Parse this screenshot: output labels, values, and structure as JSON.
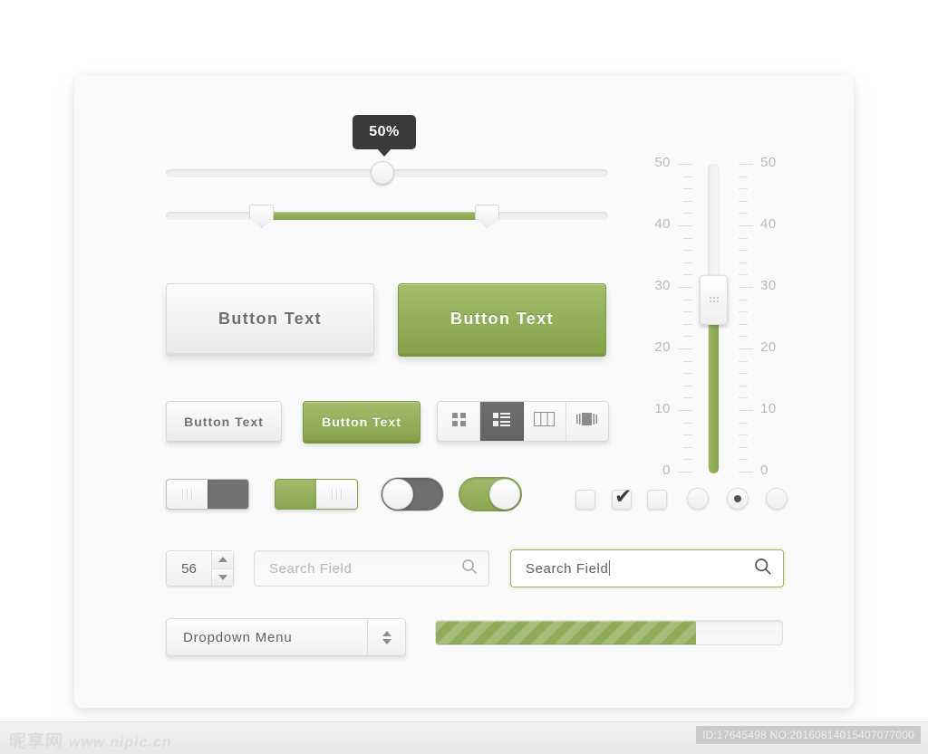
{
  "tooltip": {
    "value": "50%"
  },
  "sliders": {
    "single": {
      "value": 50,
      "min": 0,
      "max": 100,
      "tooltip": "50%"
    },
    "range": {
      "low": 19,
      "high": 70,
      "min": 0,
      "max": 100
    }
  },
  "buttons": {
    "big_light": "Button Text",
    "big_green": "Button Text",
    "small_light": "Button Text",
    "small_green": "Button Text"
  },
  "segmented": {
    "active_index": 1,
    "items": [
      {
        "icon": "grid-view-icon",
        "label": "Grid"
      },
      {
        "icon": "list-view-icon",
        "label": "List"
      },
      {
        "icon": "column-view-icon",
        "label": "Columns"
      },
      {
        "icon": "coverflow-view-icon",
        "label": "Coverflow"
      }
    ]
  },
  "toggles": [
    {
      "name": "square-toggle-off",
      "state": "off",
      "style": "square",
      "color": "#727272"
    },
    {
      "name": "square-toggle-on",
      "state": "on",
      "style": "square",
      "color": "#9ab461"
    },
    {
      "name": "round-toggle-off",
      "state": "off",
      "style": "round",
      "color": "#6e6e6e"
    },
    {
      "name": "round-toggle-on",
      "state": "on",
      "style": "round",
      "color": "#9ab461"
    }
  ],
  "checkboxes": [
    {
      "checked": false
    },
    {
      "checked": true,
      "mark": "✔"
    },
    {
      "checked": false
    }
  ],
  "radios": [
    {
      "selected": false
    },
    {
      "selected": true
    },
    {
      "selected": false
    }
  ],
  "stepper": {
    "value": "56",
    "up_icon": "triangle-up-icon",
    "down_icon": "triangle-down-icon"
  },
  "search_fields": [
    {
      "placeholder": "Search Field",
      "value": "",
      "focused": false,
      "icon": "search-icon"
    },
    {
      "placeholder": "Search Field",
      "value": "Search Field",
      "focused": true,
      "icon": "search-icon"
    }
  ],
  "dropdown": {
    "label": "Dropdown Menu",
    "icon": "up-down-arrows-icon"
  },
  "progress": {
    "percent": 75,
    "label": ""
  },
  "vertical_slider": {
    "value": 28,
    "min": 0,
    "max": 50,
    "labels": [
      "50",
      "40",
      "30",
      "20",
      "10",
      "0"
    ],
    "major_step": 10,
    "minor_step": 2
  },
  "colors": {
    "accent_green": "#9ab461",
    "accent_green_dark": "#86a44d",
    "tooltip_bg": "#3a3a3a",
    "toggle_gray": "#6e6e6e",
    "card_bg": "#fafafa",
    "text_gray": "#6d6f72"
  },
  "watermark": {
    "logo_cn": "昵享网",
    "site": "www.nipic.cn",
    "id": "ID:17645498 NO:20160814015407077000"
  }
}
